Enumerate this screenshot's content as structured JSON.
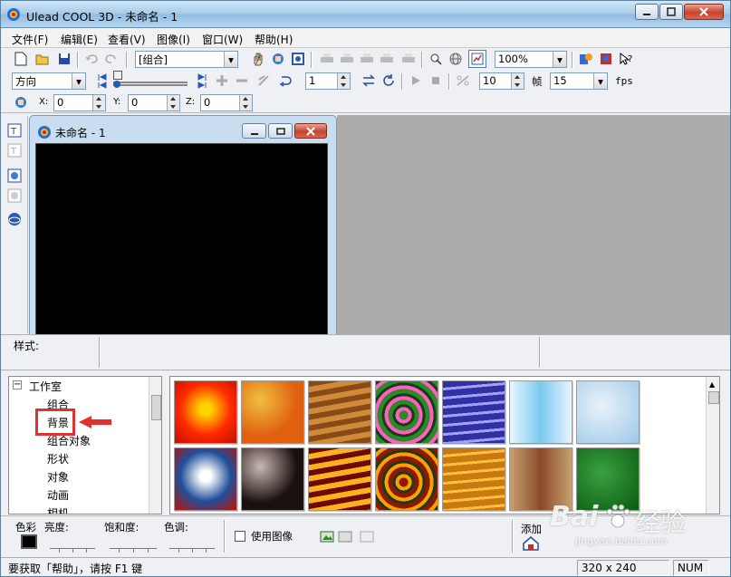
{
  "app": {
    "title": "Ulead COOL 3D - 未命名 - 1",
    "icon": "cool3d-logo-icon"
  },
  "menu": [
    "文件(F)",
    "编辑(E)",
    "查看(V)",
    "图像(I)",
    "窗口(W)",
    "帮助(H)"
  ],
  "toolbar1": {
    "object_combo": "[组合]",
    "zoom_combo": "100%"
  },
  "toolbar2": {
    "direction_combo": "方向",
    "frame_value": "1",
    "frame_count": "10",
    "frame_unit": "帧",
    "fps_value": "15",
    "fps_label": "fps"
  },
  "toolbar3": {
    "x_label": "X:",
    "x_value": "0",
    "y_label": "Y:",
    "y_value": "0",
    "z_label": "Z:",
    "z_value": "0"
  },
  "child_window": {
    "title": "未命名 - 1"
  },
  "style_bar": {
    "label": "样式:"
  },
  "tree": {
    "root": "工作室",
    "items": [
      "组合",
      "背景",
      "组合对象",
      "形状",
      "对象",
      "动画",
      "相机"
    ],
    "selected": "背景"
  },
  "gallery": {
    "thumbnails": [
      {
        "name": "bg-sunburst-orange",
        "colors": [
          "#ff2a00",
          "#ffd400"
        ]
      },
      {
        "name": "bg-fire-marble",
        "colors": [
          "#e06010",
          "#f0c040"
        ]
      },
      {
        "name": "bg-wood-grain",
        "colors": [
          "#8a4a14",
          "#d08a3c"
        ]
      },
      {
        "name": "bg-swirl-psychedelic",
        "colors": [
          "#2a8a2a",
          "#ff60c0"
        ]
      },
      {
        "name": "bg-water-ripple",
        "colors": [
          "#3030a0",
          "#a0a0ff"
        ]
      },
      {
        "name": "bg-ice-stream",
        "colors": [
          "#7ac8f0",
          "#e8f6ff"
        ]
      },
      {
        "name": "bg-frost-blue",
        "colors": [
          "#9ec8e8",
          "#e8f2fa"
        ]
      },
      {
        "name": "bg-cloud-sky",
        "colors": [
          "#1f4f9a",
          "#ffffff"
        ]
      },
      {
        "name": "bg-smoke-clouds",
        "colors": [
          "#1a1010",
          "#c8b8b0"
        ]
      },
      {
        "name": "bg-sunset-sky",
        "colors": [
          "#6a0a00",
          "#ffb020"
        ]
      },
      {
        "name": "bg-sea-sunset",
        "colors": [
          "#8a1a00",
          "#ffa000"
        ]
      },
      {
        "name": "bg-sand-weave",
        "colors": [
          "#c87a10",
          "#ffc040"
        ]
      },
      {
        "name": "bg-brick-wall",
        "colors": [
          "#8a4a2a",
          "#c8a070"
        ]
      },
      {
        "name": "bg-green-grass",
        "colors": [
          "#0a5a10",
          "#3aa040"
        ]
      }
    ]
  },
  "bottom": {
    "color_label": "色彩",
    "brightness_label": "亮度:",
    "saturation_label": "饱和度:",
    "hue_label": "色调:",
    "use_image_label": "使用图像",
    "add_label": "添加"
  },
  "status": {
    "hint": "要获取「帮助」，请按 F1 键",
    "size": "320 x 240",
    "num": "NUM"
  },
  "watermark": {
    "brand": "Bai",
    "brand_cn": "经验",
    "url": "jingyan.baidu.com"
  },
  "colors": {
    "title_gradient_top": "#cfe6f8",
    "accent_red": "#d33333",
    "workspace_gray": "#ababab"
  }
}
